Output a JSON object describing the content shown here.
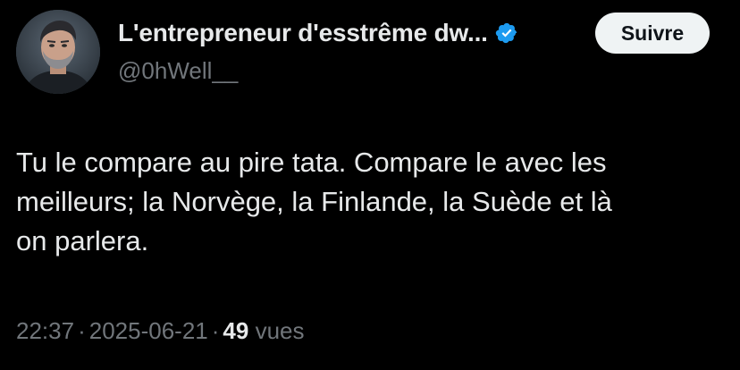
{
  "author": {
    "display_name": "L'entrepreneur d'esstrême dw...",
    "handle": "@0hWell__",
    "verified_icon": "verified-badge-icon",
    "avatar": "avatar-photo"
  },
  "follow_button": {
    "label": "Suivre"
  },
  "tweet": {
    "lines": [
      "Tu le compare au pire tata. Compare le avec les",
      "meilleurs; la Norvège, la Finlande, la Suède et là",
      "on parlera."
    ]
  },
  "meta": {
    "time": "22:37",
    "separator": "·",
    "date": "2025-06-21",
    "views_count": "49",
    "views_label": "vues"
  },
  "colors": {
    "background": "#000000",
    "text_primary": "#e7e9ea",
    "text_secondary": "#71767b",
    "verified_blue": "#1d9bf0",
    "button_bg": "#eff3f4"
  }
}
